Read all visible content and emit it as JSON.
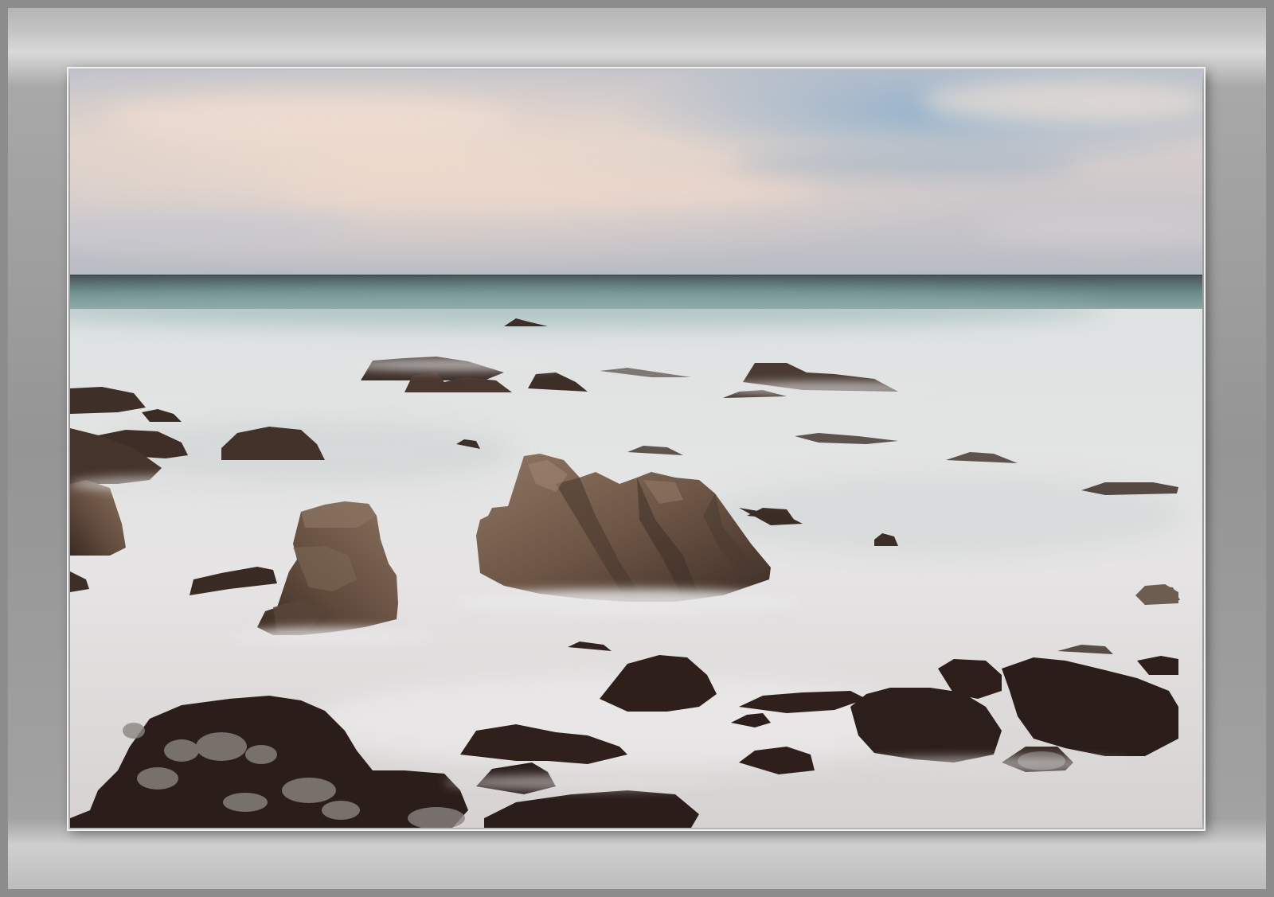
{
  "image": {
    "subject": "rocky-seascape-long-exposure",
    "colors": {
      "sky_top": "#b9bfca",
      "sky_warm": "#e6d3c6",
      "sky_blue": "#9fb4c8",
      "ocean_horizon": "#4d5a5c",
      "ocean_teal": "#6f8f8f",
      "mist": "#e4e2e2",
      "rock_brown": "#6e5646",
      "rock_dark": "#2c1e1a",
      "frame_gray": "#9a9a9a"
    }
  }
}
